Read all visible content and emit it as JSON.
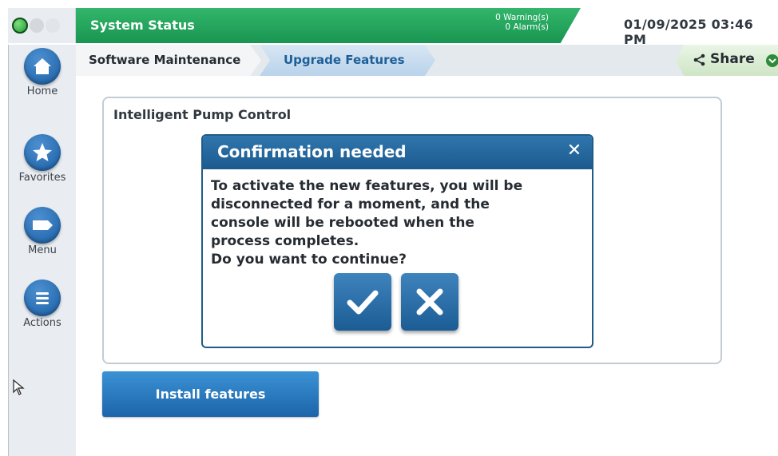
{
  "header": {
    "title": "System Status",
    "warnings": "0 Warning(s)",
    "alarms": "0 Alarm(s)",
    "datetime": "01/09/2025 03:46 PM"
  },
  "sidebar": {
    "items": [
      {
        "label": "Home",
        "icon": "home-icon"
      },
      {
        "label": "Favorites",
        "icon": "star-icon"
      },
      {
        "label": "Menu",
        "icon": "menu-icon"
      },
      {
        "label": "Actions",
        "icon": "actions-icon"
      }
    ]
  },
  "breadcrumb": {
    "items": [
      "Software Maintenance",
      "Upgrade Features"
    ]
  },
  "share": {
    "label": "Share"
  },
  "panel": {
    "title": "Intelligent Pump Control"
  },
  "install_button": {
    "label": "Install features"
  },
  "modal": {
    "title": "Confirmation needed",
    "close": "✕",
    "message_lines": [
      "To activate the new features, you will be",
      "disconnected for a moment, and the",
      "console will be rebooted when the",
      "process completes.",
      "Do you want to continue?"
    ]
  },
  "colors": {
    "status_green": "#1f9e58",
    "primary_blue": "#1d64aa",
    "breadcrumb_active_text": "#1e5f98"
  }
}
